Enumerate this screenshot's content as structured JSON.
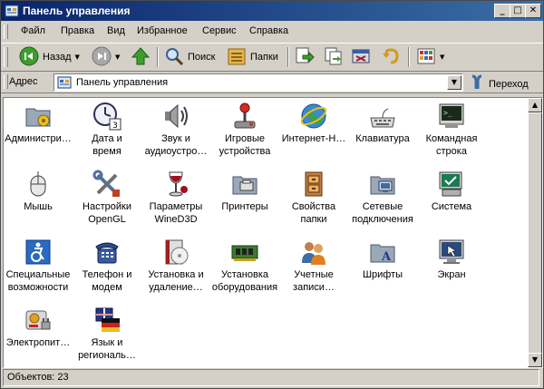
{
  "window": {
    "title": "Панель управления"
  },
  "menu": [
    "Файл",
    "Правка",
    "Вид",
    "Избранное",
    "Сервис",
    "Справка"
  ],
  "toolbar": {
    "back": "Назад",
    "search": "Поиск",
    "folders": "Папки"
  },
  "address": {
    "label": "Адрес",
    "value": "Панель управления",
    "go": "Переход"
  },
  "items": [
    {
      "label": "Администри…",
      "icon": "administration-icon"
    },
    {
      "label": "Дата и\nвремя",
      "icon": "date-time-icon"
    },
    {
      "label": "Звук и\nаудиоустро…",
      "icon": "sound-icon"
    },
    {
      "label": "Игровые\nустройства",
      "icon": "joystick-icon"
    },
    {
      "label": "Интернет-Н…",
      "icon": "internet-icon"
    },
    {
      "label": "Клавиатура",
      "icon": "keyboard-icon"
    },
    {
      "label": "Командная\nстрока",
      "icon": "console-icon"
    },
    {
      "label": "Мышь",
      "icon": "mouse-icon"
    },
    {
      "label": "Настройки\nOpenGL",
      "icon": "tools-icon"
    },
    {
      "label": "Параметры\nWineD3D",
      "icon": "wine-icon"
    },
    {
      "label": "Принтеры",
      "icon": "printer-folder-icon"
    },
    {
      "label": "Свойства\nпапки",
      "icon": "folder-options-icon"
    },
    {
      "label": "Сетевые\nподключения",
      "icon": "network-icon"
    },
    {
      "label": "Система",
      "icon": "system-icon"
    },
    {
      "label": "Специальные\nвозможности",
      "icon": "accessibility-icon"
    },
    {
      "label": "Телефон и\nмодем",
      "icon": "phone-icon"
    },
    {
      "label": "Установка и\nудаление…",
      "icon": "install-icon"
    },
    {
      "label": "Установка\nоборудования",
      "icon": "hardware-icon"
    },
    {
      "label": "Учетные\nзаписи…",
      "icon": "users-icon"
    },
    {
      "label": "Шрифты",
      "icon": "fonts-icon"
    },
    {
      "label": "Экран",
      "icon": "display-icon"
    },
    {
      "label": "Электропит…",
      "icon": "power-icon"
    },
    {
      "label": "Язык и\nрегиональ…",
      "icon": "language-icon"
    }
  ],
  "status": "Объектов: 23"
}
